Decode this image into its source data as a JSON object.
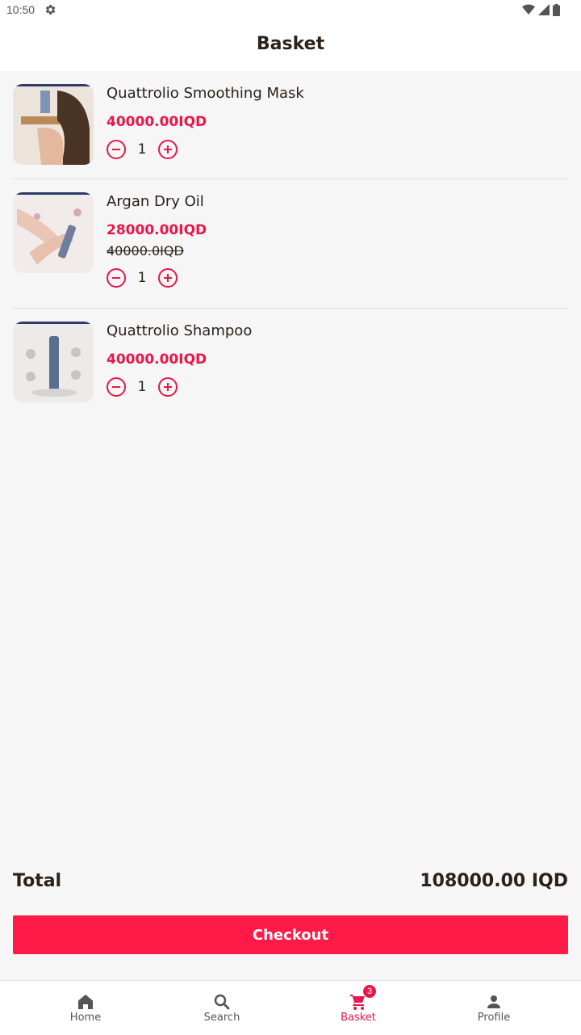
{
  "status": {
    "time": "10:50"
  },
  "header": {
    "title": "Basket"
  },
  "items": [
    {
      "name": "Quattrolio Smoothing Mask",
      "price": "40000.00IQD",
      "old_price": "",
      "qty": "1"
    },
    {
      "name": "Argan Dry Oil",
      "price": "28000.00IQD",
      "old_price": "40000.0IQD",
      "qty": "1"
    },
    {
      "name": "Quattrolio Shampoo",
      "price": "40000.00IQD",
      "old_price": "",
      "qty": "1"
    }
  ],
  "summary": {
    "total_label": "Total",
    "total_value": "108000.00 IQD"
  },
  "checkout": {
    "label": "Checkout"
  },
  "nav": {
    "items": [
      {
        "label": "Home",
        "icon": "home-icon"
      },
      {
        "label": "Search",
        "icon": "search-icon"
      },
      {
        "label": "Basket",
        "icon": "cart-icon",
        "badge": "3",
        "active": true
      },
      {
        "label": "Profile",
        "icon": "person-icon"
      }
    ]
  },
  "colors": {
    "accent": "#ff1a47",
    "price": "#e8174a",
    "text": "#2b2118",
    "background": "#f6f6f6"
  }
}
